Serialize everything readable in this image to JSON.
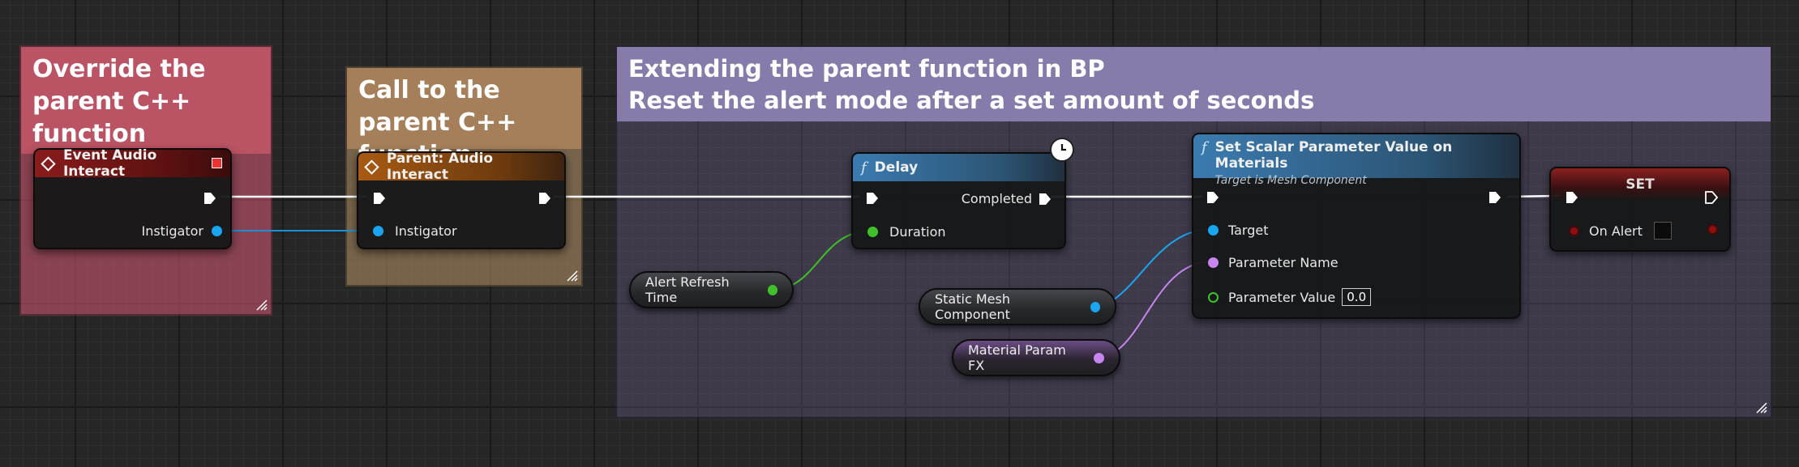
{
  "comments": {
    "override": "Override the parent C++ function",
    "call_parent": "Call to the parent C++ function",
    "extend_line1": "Extending the parent function in BP",
    "extend_line2": "Reset the alert mode after a set amount of seconds"
  },
  "nodes": {
    "event": {
      "title": "Event Audio Interact",
      "pin_instigator": "Instigator"
    },
    "parent": {
      "title": "Parent: Audio Interact",
      "pin_instigator": "Instigator"
    },
    "delay": {
      "title": "Delay",
      "pin_completed": "Completed",
      "pin_duration": "Duration"
    },
    "set_scalar": {
      "title": "Set Scalar Parameter Value on Materials",
      "subtitle": "Target is Mesh Component",
      "pin_target": "Target",
      "pin_parameter_name": "Parameter Name",
      "pin_parameter_value": "Parameter Value",
      "parameter_value": "0.0"
    },
    "set": {
      "title": "SET",
      "pin_on_alert": "On Alert"
    }
  },
  "variables": {
    "alert_refresh_time": "Alert Refresh Time",
    "static_mesh_component": "Static Mesh Component",
    "material_param_fx": "Material Param FX"
  },
  "colors": {
    "float_pin": "#3fc12a",
    "object_pin": "#1aa5f0",
    "name_pin": "#c785f0",
    "bool_pin": "#8e0f0f",
    "exec_wire": "#ffffff"
  }
}
